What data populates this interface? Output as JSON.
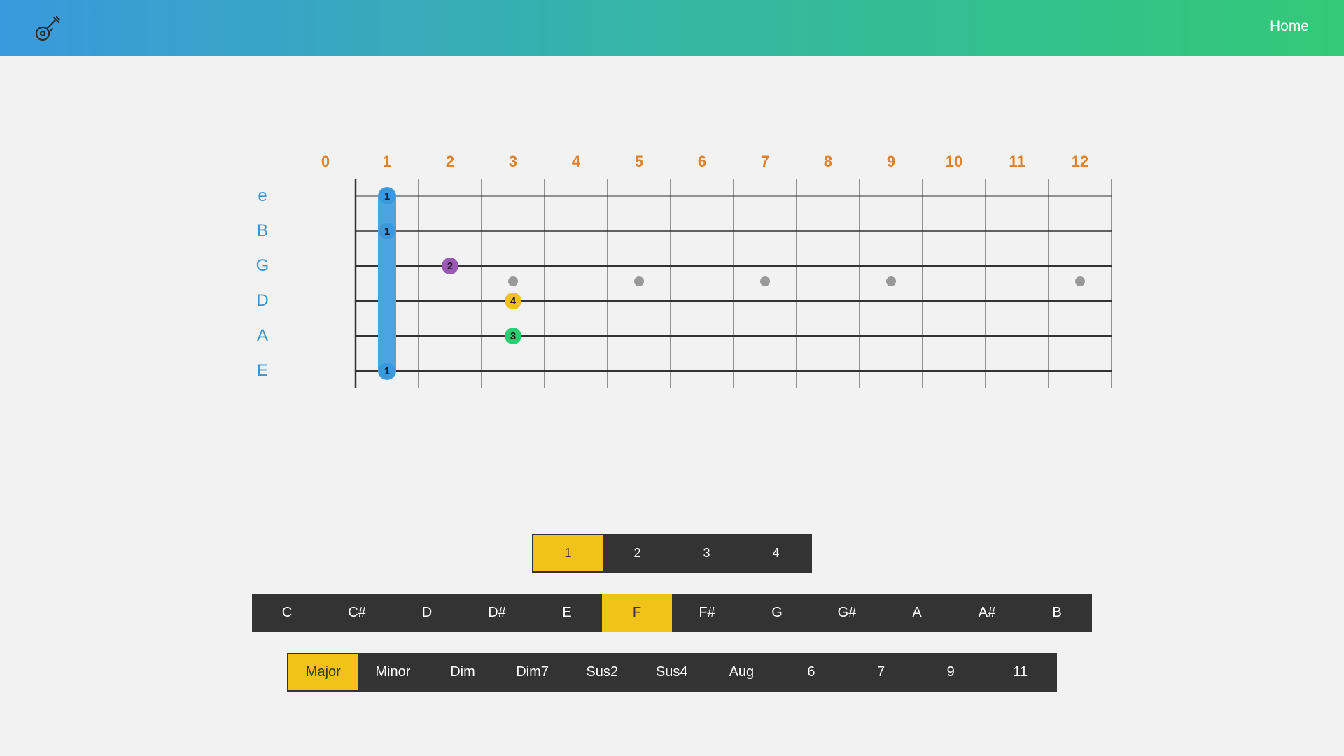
{
  "header": {
    "logo_icon": "guitar-icon",
    "nav_home": "Home",
    "gradient_start": "#3a99dd",
    "gradient_end": "#33c978"
  },
  "fretboard": {
    "fret_numbers": [
      "0",
      "1",
      "2",
      "3",
      "4",
      "5",
      "6",
      "7",
      "8",
      "9",
      "10",
      "11",
      "12"
    ],
    "strings": [
      "e",
      "B",
      "G",
      "D",
      "A",
      "E"
    ],
    "fret_markers": [
      3,
      5,
      7,
      9,
      12
    ],
    "barre": {
      "fret": 1,
      "from_string": 0,
      "to_string": 5,
      "finger": "1"
    },
    "notes": [
      {
        "string": 0,
        "fret": 1,
        "finger": "1",
        "color": "#3a99dd"
      },
      {
        "string": 1,
        "fret": 1,
        "finger": "1",
        "color": "#3a99dd"
      },
      {
        "string": 2,
        "fret": 2,
        "finger": "2",
        "color": "#9b59b6"
      },
      {
        "string": 3,
        "fret": 3,
        "finger": "4",
        "color": "#f0c21a"
      },
      {
        "string": 4,
        "fret": 3,
        "finger": "3",
        "color": "#2ecc71"
      },
      {
        "string": 5,
        "fret": 1,
        "finger": "1",
        "color": "#3a99dd"
      }
    ]
  },
  "positions": {
    "options": [
      "1",
      "2",
      "3",
      "4"
    ],
    "selected": "1"
  },
  "roots": {
    "options": [
      "C",
      "C#",
      "D",
      "D#",
      "E",
      "F",
      "F#",
      "G",
      "G#",
      "A",
      "A#",
      "B"
    ],
    "selected": "F"
  },
  "chord_types": {
    "options": [
      "Major",
      "Minor",
      "Dim",
      "Dim7",
      "Sus2",
      "Sus4",
      "Aug",
      "6",
      "7",
      "9",
      "11"
    ],
    "selected": "Major"
  },
  "colors": {
    "accent": "#f0c21a",
    "fret_number": "#e0822b",
    "string_label": "#3996d4",
    "selector_bg": "#333333"
  }
}
